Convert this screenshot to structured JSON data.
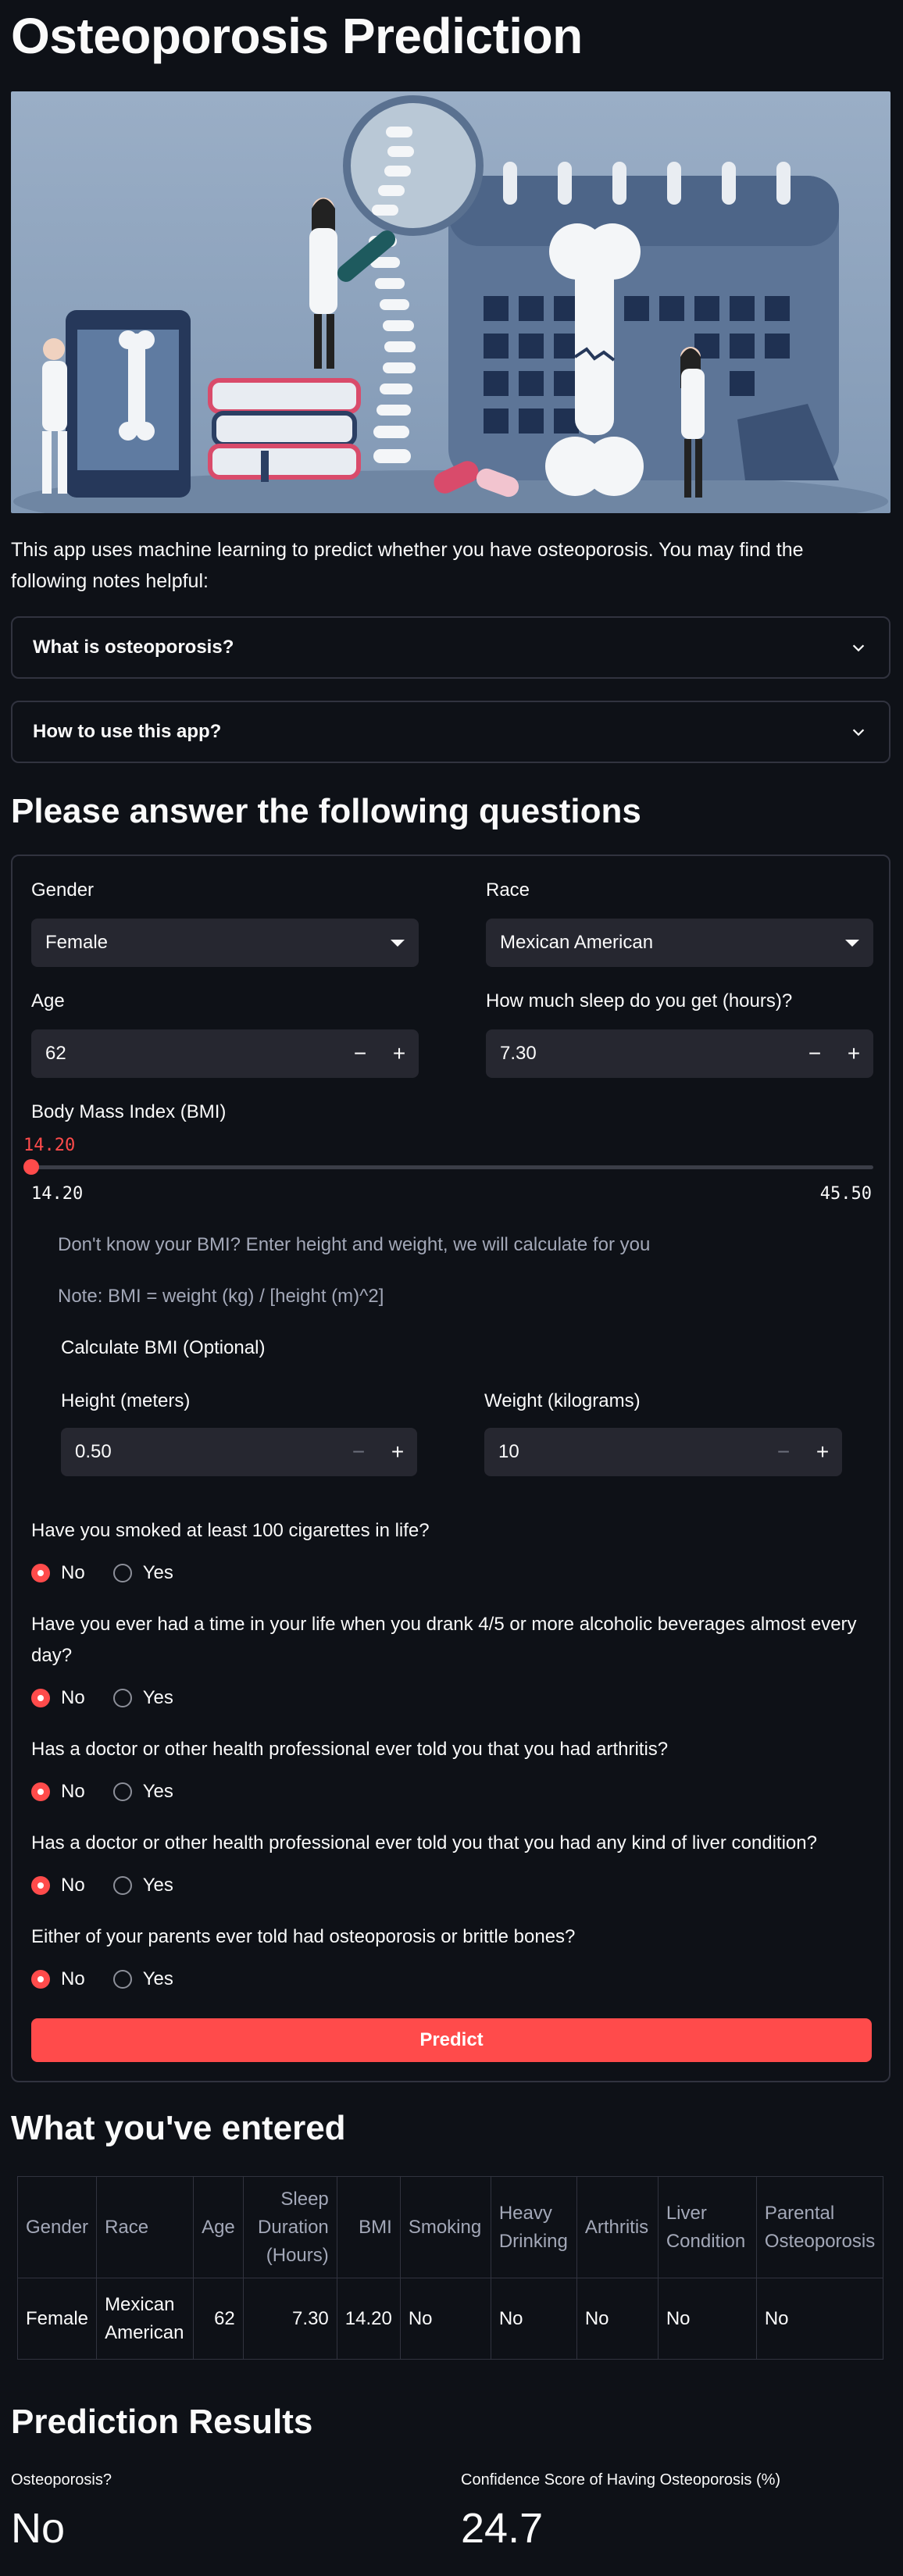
{
  "title": "Osteoporosis Prediction",
  "intro": "This app uses machine learning to predict whether you have osteoporosis. You may find the following notes helpful:",
  "expanders": [
    {
      "label": "What is osteoporosis?"
    },
    {
      "label": "How to use this app?"
    }
  ],
  "form_heading": "Please answer the following questions",
  "form": {
    "gender": {
      "label": "Gender",
      "value": "Female"
    },
    "race": {
      "label": "Race",
      "value": "Mexican American"
    },
    "age": {
      "label": "Age",
      "value": "62"
    },
    "sleep": {
      "label": "How much sleep do you get (hours)?",
      "value": "7.30"
    },
    "bmi": {
      "label": "Body Mass Index (BMI)",
      "value": "14.20",
      "min": "14.20",
      "max": "45.50",
      "fraction": 0.0
    },
    "bmi_hint": "Don't know your BMI? Enter height and weight, we will calculate for you",
    "bmi_note": "Note: BMI = weight (kg) / [height (m)^2]",
    "calc_title": "Calculate BMI (Optional)",
    "height": {
      "label": "Height (meters)",
      "value": "0.50"
    },
    "weight": {
      "label": "Weight (kilograms)",
      "value": "10"
    },
    "questions": [
      {
        "text": "Have you smoked at least 100 cigarettes in life?",
        "options": [
          "No",
          "Yes"
        ],
        "selected": "No"
      },
      {
        "text": "Have you ever had a time in your life when you drank 4/5 or more alcoholic beverages almost every day?",
        "options": [
          "No",
          "Yes"
        ],
        "selected": "No"
      },
      {
        "text": "Has a doctor or other health professional ever told you that you had arthritis?",
        "options": [
          "No",
          "Yes"
        ],
        "selected": "No"
      },
      {
        "text": "Has a doctor or other health professional ever told you that you had any kind of liver condition?",
        "options": [
          "No",
          "Yes"
        ],
        "selected": "No"
      },
      {
        "text": "Either of your parents ever told had osteoporosis or brittle bones?",
        "options": [
          "No",
          "Yes"
        ],
        "selected": "No"
      }
    ],
    "predict_label": "Predict"
  },
  "entered_heading": "What you've entered",
  "table": {
    "headers": [
      "Gender",
      "Race",
      "Age",
      "Sleep Duration (Hours)",
      "BMI",
      "Smoking",
      "Heavy Drinking",
      "Arthritis",
      "Liver Condition",
      "Parental Osteoporosis"
    ],
    "row": [
      "Female",
      "Mexican American",
      "62",
      "7.30",
      "14.20",
      "No",
      "No",
      "No",
      "No",
      "No"
    ]
  },
  "results_heading": "Prediction Results",
  "results": {
    "osteo_label": "Osteoporosis?",
    "osteo_value": "No",
    "conf_label": "Confidence Score of Having Osteoporosis (%)",
    "conf_value": "24.7"
  },
  "colors": {
    "accent": "#ff4b4b",
    "background": "#0e1117",
    "input": "#262730"
  },
  "icons": [
    "chevron-down-icon",
    "caret-down-icon",
    "minus-icon",
    "plus-icon"
  ]
}
